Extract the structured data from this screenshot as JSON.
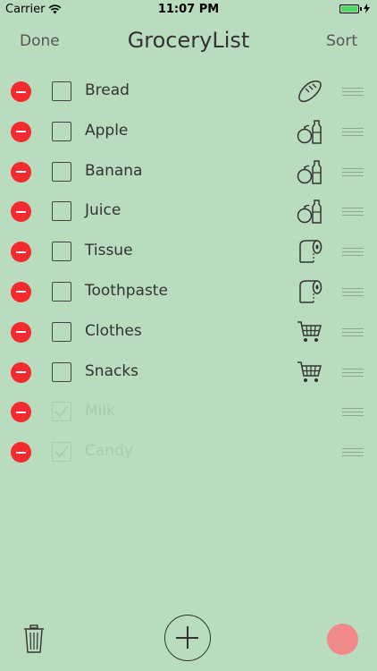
{
  "status": {
    "carrier": "Carrier",
    "time": "11:07 PM",
    "battery_fraction": 1.0,
    "battery_color": "#4cd964"
  },
  "nav": {
    "left": "Done",
    "title": "GroceryList",
    "right": "Sort"
  },
  "items": [
    {
      "label": "Bread",
      "checked": false,
      "icon": "bread-icon"
    },
    {
      "label": "Apple",
      "checked": false,
      "icon": "groceries-icon"
    },
    {
      "label": "Banana",
      "checked": false,
      "icon": "groceries-icon"
    },
    {
      "label": "Juice",
      "checked": false,
      "icon": "groceries-icon"
    },
    {
      "label": "Tissue",
      "checked": false,
      "icon": "toilet-paper-icon"
    },
    {
      "label": "Toothpaste",
      "checked": false,
      "icon": "toilet-paper-icon"
    },
    {
      "label": "Clothes",
      "checked": false,
      "icon": "cart-icon"
    },
    {
      "label": "Snacks",
      "checked": false,
      "icon": "cart-icon"
    },
    {
      "label": "Milk",
      "checked": true,
      "icon": ""
    },
    {
      "label": "Candy",
      "checked": true,
      "icon": ""
    }
  ],
  "toolbar": {
    "trash_icon": "trash-icon",
    "add_icon": "plus-icon",
    "accent_color": "#f08a8a"
  },
  "colors": {
    "background": "#b9dcbe",
    "delete": "#f42a2f",
    "checked_text": "#a9c9ae"
  }
}
